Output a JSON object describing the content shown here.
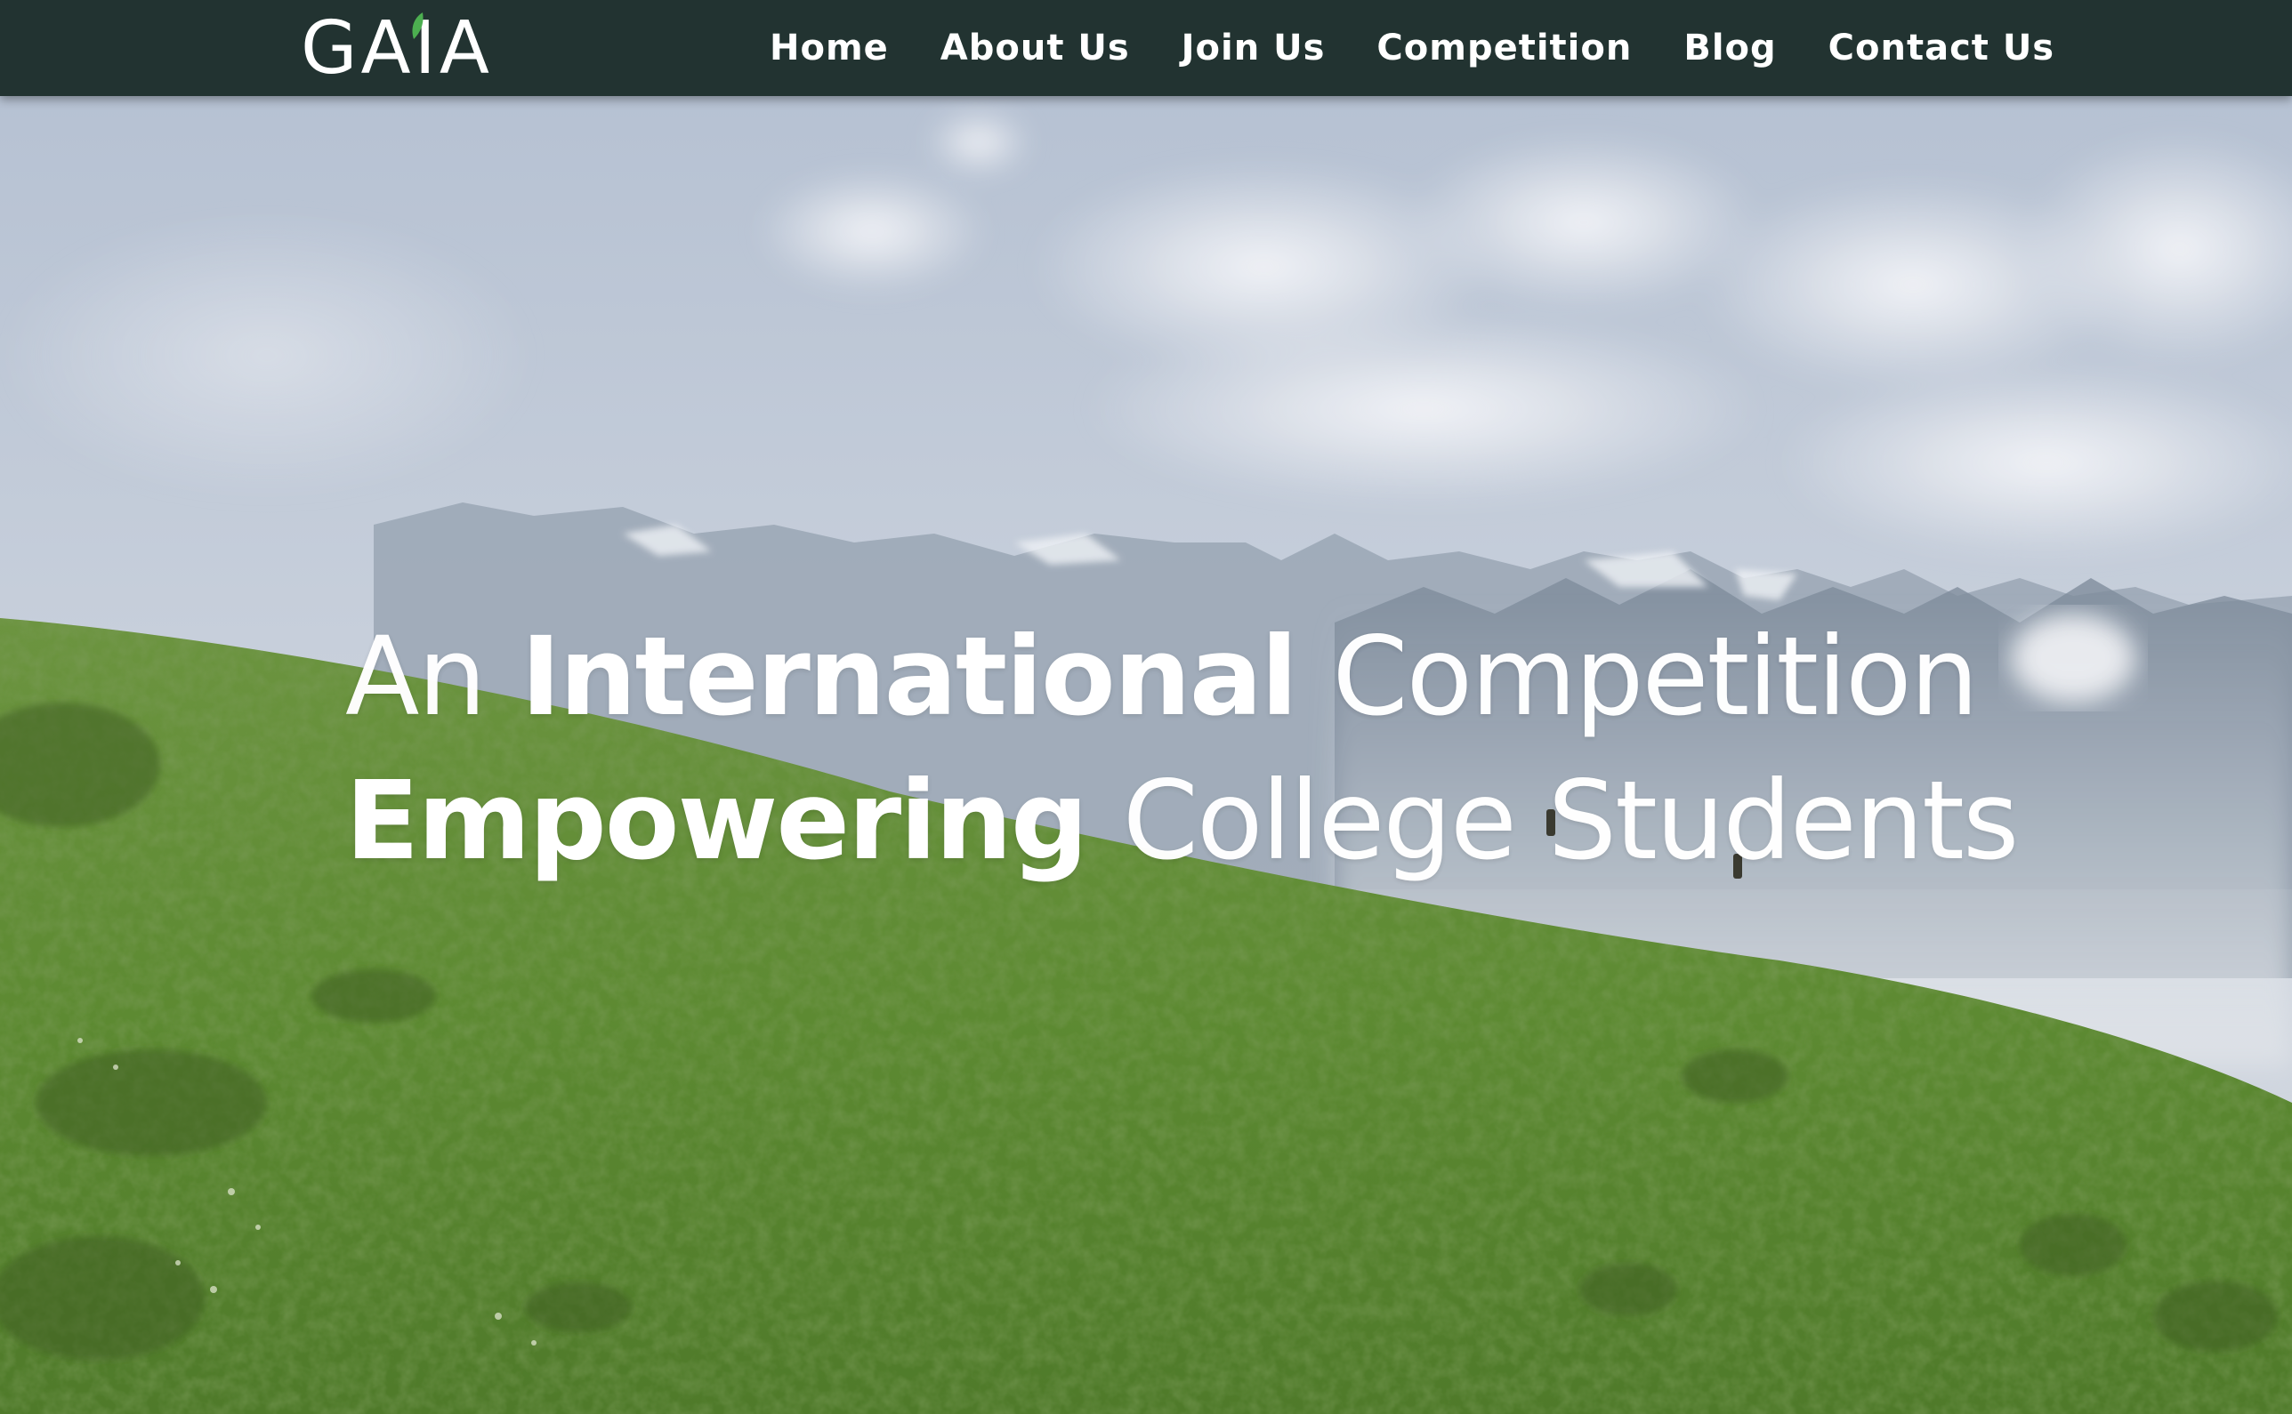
{
  "brand": {
    "logo_text": "GAIA"
  },
  "nav": {
    "items": [
      {
        "label": "Home"
      },
      {
        "label": "About Us"
      },
      {
        "label": "Join Us"
      },
      {
        "label": "Competition"
      },
      {
        "label": "Blog"
      },
      {
        "label": "Contact Us"
      }
    ]
  },
  "hero": {
    "line1": {
      "part1": "An",
      "part2": "International",
      "part3": "Competition"
    },
    "line2": {
      "part1": "Empowering",
      "part2": "College Students"
    }
  },
  "colors": {
    "navbar_bg": "#223331",
    "logo_leaf": "#4caf50",
    "text": "#ffffff",
    "hill_green": "#5a8a2e",
    "sky": "#b9c4d4"
  }
}
